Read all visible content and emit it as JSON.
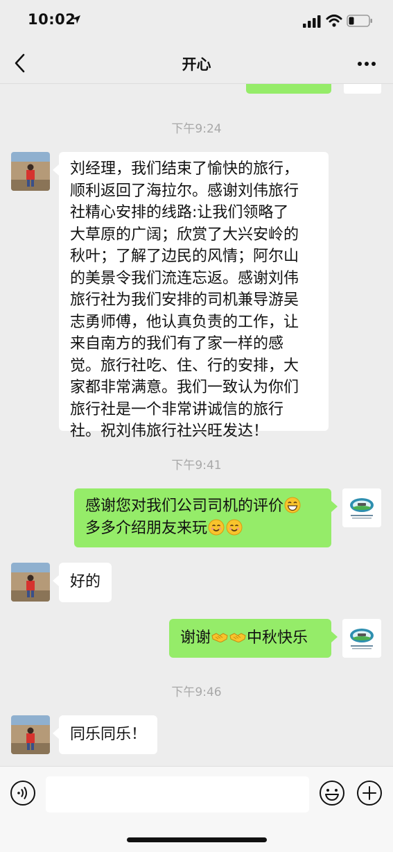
{
  "status_bar": {
    "time": "10:02"
  },
  "header": {
    "title": "开心"
  },
  "messages": [
    {
      "type": "timestamp",
      "text": "下午9:24"
    },
    {
      "type": "incoming",
      "text": "刘经理，我们结束了愉快的旅行，顺利返回了海拉尔。感谢刘伟旅行社精心安排的线路:让我们领略了大草原的广阔；欣赏了大兴安岭的秋叶；了解了边民的风情；阿尔山的美景令我们流连忘返。感谢刘伟旅行社为我们安排的司机兼导游吴志勇师傅，他认真负责的工作，让来自南方的我们有了家一样的感觉。旅行社吃、住、行的安排，大家都非常满意。我们一致认为你们旅行社是一个非常讲诚信的旅行社。祝刘伟旅行社兴旺发达！",
      "lines": [
        "刘经理，我们结束了愉快的旅行，",
        "顺利返回了海拉尔。感谢刘伟旅行",
        "社精心安排的线路:让我们领略了",
        "大草原的广阔；欣赏了大兴安岭的",
        "秋叶；了解了边民的风情；阿尔山",
        "的美景令我们流连忘返。感谢刘伟",
        "旅行社为我们安排的司机兼导游吴",
        "志勇师傅，他认真负责的工作，让",
        "来自南方的我们有了家一样的感",
        "觉。旅行社吃、住、行的安排，大",
        "家都非常满意。我们一致认为你们",
        "旅行社是一个非常讲诚信的旅行",
        "社。祝刘伟旅行社兴旺发达！"
      ]
    },
    {
      "type": "timestamp",
      "text": "下午9:41"
    },
    {
      "type": "outgoing",
      "line1": "感谢您对我们公司司机的评价",
      "line2": "多多介绍朋友来玩",
      "emojis": [
        "grin-emoji",
        "smile-emoji",
        "smile-emoji"
      ]
    },
    {
      "type": "incoming",
      "text": "好的"
    },
    {
      "type": "outgoing",
      "before": "谢谢",
      "after": "中秋快乐",
      "emojis": [
        "handshake-emoji",
        "handshake-emoji"
      ]
    },
    {
      "type": "timestamp",
      "text": "下午9:46"
    },
    {
      "type": "incoming",
      "text": "同乐同乐！"
    }
  ],
  "colors": {
    "outgoing_bubble": "#95ec69",
    "incoming_bubble": "#ffffff",
    "background": "#ededed"
  }
}
